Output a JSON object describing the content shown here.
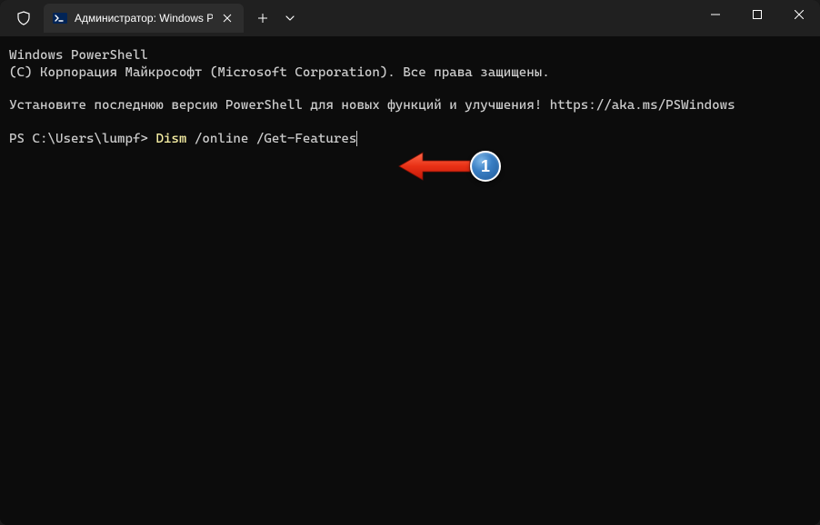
{
  "titlebar": {
    "tab_title": "Администратор: Windows Po"
  },
  "terminal": {
    "line1": "Windows PowerShell",
    "line2": "(C) Корпорация Майкрософт (Microsoft Corporation). Все права защищены.",
    "line3": "Установите последнюю версию PowerShell для новых функций и улучшения! https://aka.ms/PSWindows",
    "prompt": "PS C:\\Users\\lumpf> ",
    "command_name": "Dism",
    "command_args": " /online /Get-Features"
  },
  "annotation": {
    "badge_number": "1"
  }
}
